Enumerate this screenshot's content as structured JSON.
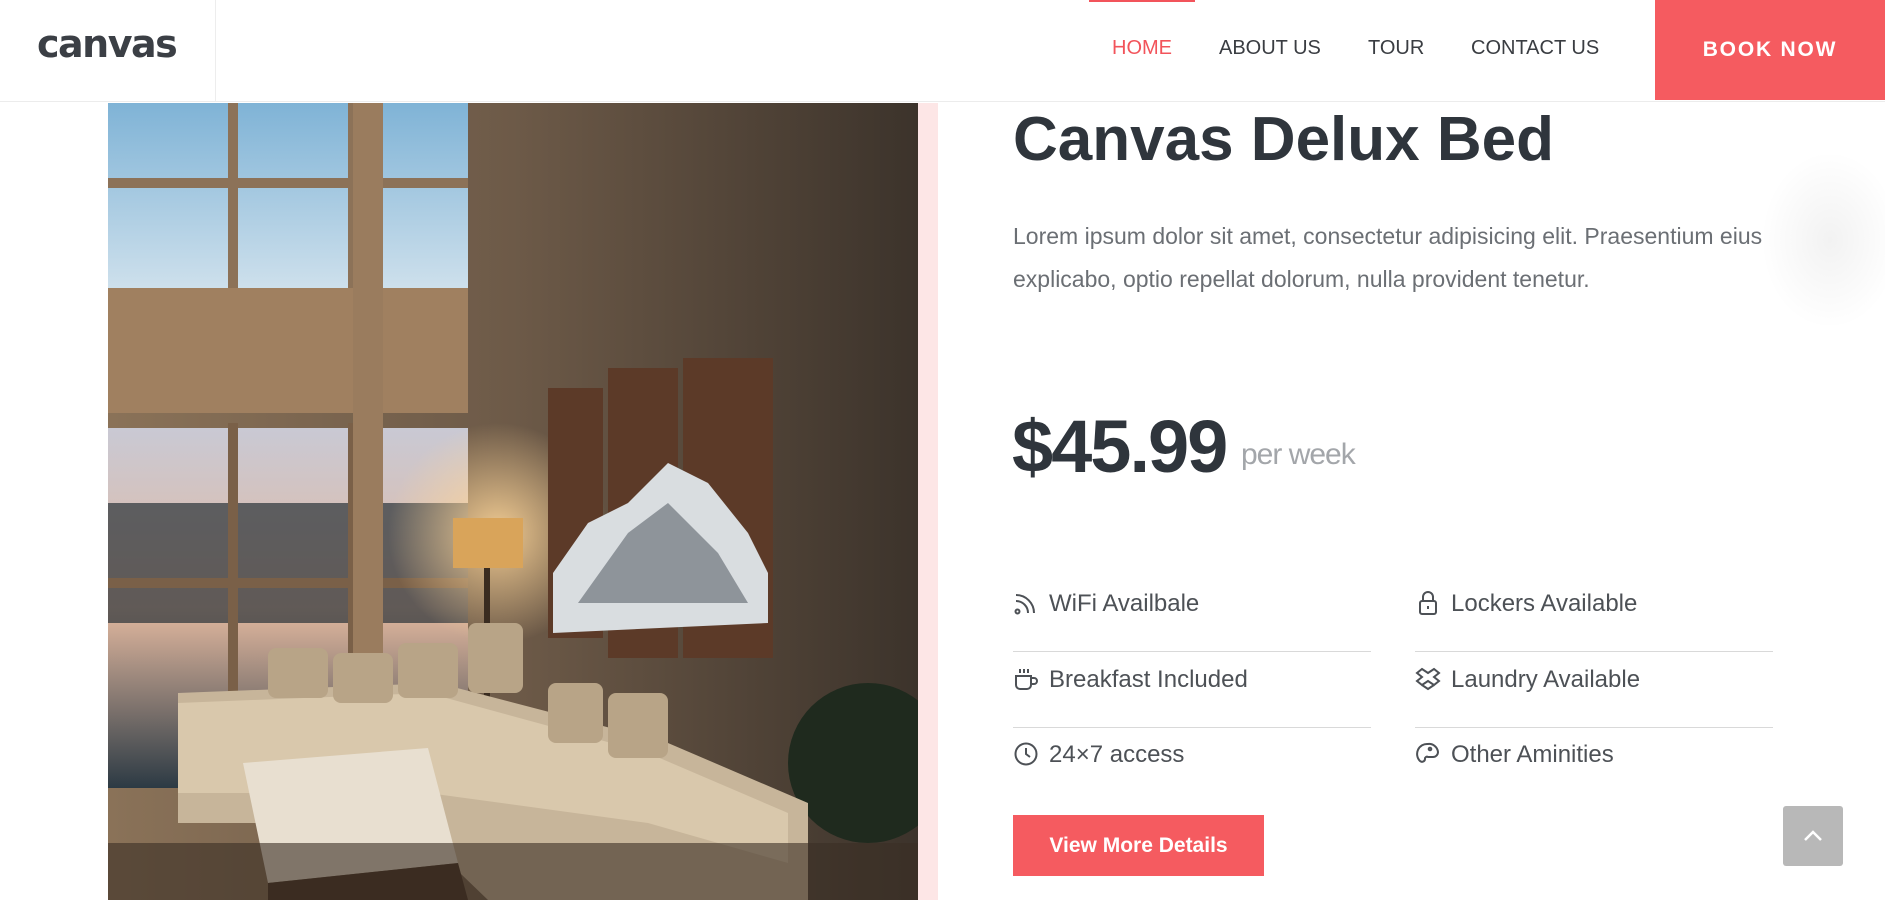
{
  "header": {
    "logo": "canvas",
    "nav": [
      {
        "label": "HOME",
        "active": true
      },
      {
        "label": "ABOUT US",
        "active": false
      },
      {
        "label": "TOUR",
        "active": false
      },
      {
        "label": "CONTACT US",
        "active": false
      }
    ],
    "book_label": "BOOK NOW"
  },
  "product": {
    "title": "Canvas Delux Bed",
    "description": "Lorem ipsum dolor sit amet, consectetur adipisicing elit. Praesentium eius explicabo, optio repellat dolorum, nulla provident tenetur.",
    "price": "$45.99",
    "price_unit": "per week"
  },
  "features": [
    {
      "label": "WiFi Availbale",
      "icon": "wifi-icon"
    },
    {
      "label": "Lockers Available",
      "icon": "lock-icon"
    },
    {
      "label": "Breakfast Included",
      "icon": "coffee-cup-icon"
    },
    {
      "label": "Laundry Available",
      "icon": "laundry-icon"
    },
    {
      "label": "24×7 access",
      "icon": "clock-icon"
    },
    {
      "label": "Other Aminities",
      "icon": "palette-icon"
    }
  ],
  "cta": {
    "label": "View More Details"
  },
  "colors": {
    "accent": "#f55b60",
    "heading": "#2f353c",
    "text": "#6b6f74"
  }
}
